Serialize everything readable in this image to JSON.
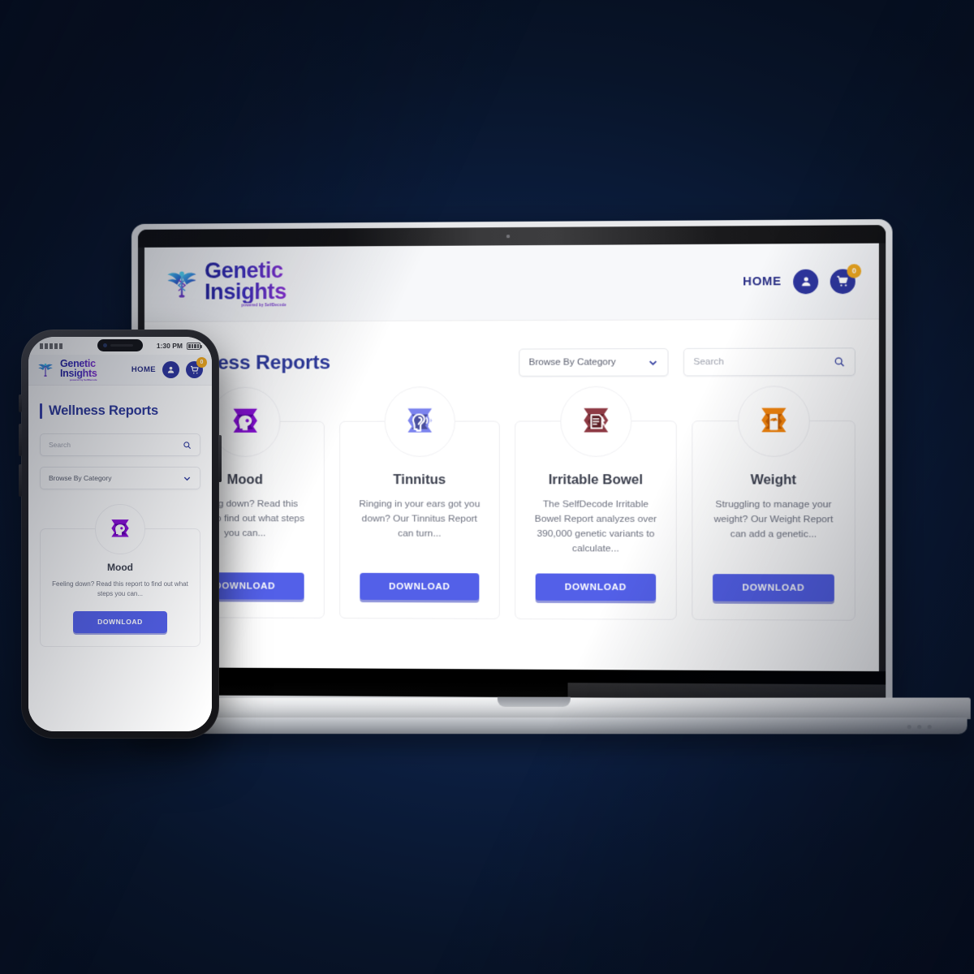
{
  "brand": {
    "line1": "Genetic",
    "line2": "Insights",
    "tagline": "powered by SelfDecode"
  },
  "desktop": {
    "nav": {
      "home_label": "HOME",
      "account_icon": "user-icon",
      "cart_icon": "cart-icon",
      "cart_count": "0"
    },
    "page_title": "Wellness Reports",
    "category_select": {
      "value": "Browse By Category",
      "chevron_icon": "chevron-down-icon"
    },
    "search": {
      "placeholder": "Search",
      "value": "",
      "icon": "search-icon"
    },
    "cards": [
      {
        "title": "Mood",
        "description": "Feeling down? Read this report to find out what steps you can...",
        "button": "DOWNLOAD",
        "icon": "mood-report-icon",
        "color": "#8a0fd8"
      },
      {
        "title": "Tinnitus",
        "description": "Ringing in your ears got you down? Our Tinnitus Report can turn...",
        "button": "DOWNLOAD",
        "icon": "tinnitus-report-icon",
        "color": "#7b83ee"
      },
      {
        "title": "Irritable Bowel",
        "description": "The SelfDecode Irritable Bowel Report analyzes over 390,000 genetic variants to calculate...",
        "button": "DOWNLOAD",
        "icon": "irritable-bowel-report-icon",
        "color": "#8e3a44"
      },
      {
        "title": "Weight",
        "description": "Struggling to manage your weight? Our Weight Report can add a genetic...",
        "button": "DOWNLOAD",
        "icon": "weight-report-icon",
        "color": "#f2840c"
      }
    ]
  },
  "phone": {
    "statusbar": {
      "time": "1:30 PM",
      "signal_icon": "signal-dots-icon",
      "battery_icon": "battery-icon"
    },
    "nav": {
      "home_label": "HOME",
      "account_icon": "user-icon",
      "cart_icon": "cart-icon",
      "cart_count": "0"
    },
    "page_title": "Wellness Reports",
    "search": {
      "placeholder": "Search",
      "value": "",
      "icon": "search-icon"
    },
    "category_select": {
      "value": "Browse By Category",
      "chevron_icon": "chevron-down-icon"
    },
    "card": {
      "title": "Mood",
      "description": "Feeling down? Read this report to find out what steps you can...",
      "button": "DOWNLOAD",
      "icon": "mood-report-icon"
    }
  },
  "colors": {
    "background": "#0a1730",
    "brand_blue": "#2f37a0",
    "accent_purple": "#8b2fd6",
    "button_blue": "#5360e8",
    "badge_orange": "#f0a91e",
    "title_blue": "#2f3b9e"
  }
}
